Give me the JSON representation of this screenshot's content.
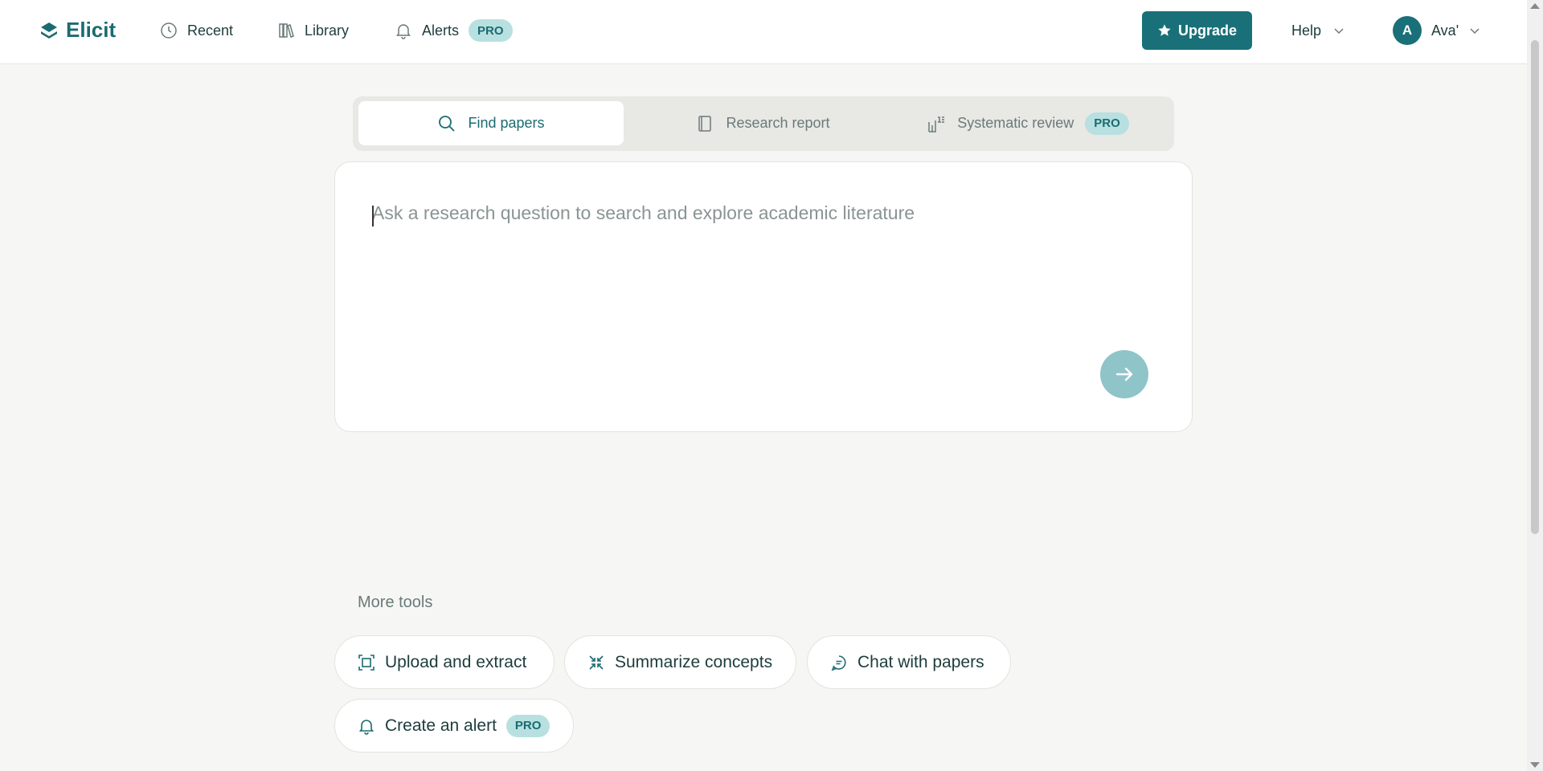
{
  "header": {
    "logo_text": "Elicit",
    "nav": [
      {
        "label": "Recent",
        "icon": "clock-icon"
      },
      {
        "label": "Library",
        "icon": "books-icon"
      },
      {
        "label": "Alerts",
        "icon": "bell-icon",
        "badge": "PRO"
      }
    ],
    "upgrade_label": "Upgrade",
    "help_label": "Help",
    "user": {
      "initial": "A",
      "name": "Ava'"
    }
  },
  "tabs": [
    {
      "label": "Find papers",
      "icon": "search-icon",
      "active": true
    },
    {
      "label": "Research report",
      "icon": "book-icon",
      "active": false
    },
    {
      "label": "Systematic review",
      "icon": "ranked-list-icon",
      "badge": "PRO",
      "active": false
    }
  ],
  "search": {
    "placeholder": "Ask a research question to search and explore academic literature",
    "value": ""
  },
  "more_tools": {
    "title": "More tools",
    "items": [
      {
        "label": "Upload and extract",
        "icon": "scan-icon"
      },
      {
        "label": "Summarize concepts",
        "icon": "compress-icon"
      },
      {
        "label": "Chat with papers",
        "icon": "chat-icon"
      },
      {
        "label": "Create an alert",
        "icon": "bell-icon",
        "badge": "PRO"
      }
    ]
  },
  "colors": {
    "brand": "#1a6b72",
    "accent_button": "#1a7078",
    "badge_bg": "#b8e0e0",
    "page_bg": "#f6f6f4",
    "submit_disabled": "#8fc4c9"
  }
}
